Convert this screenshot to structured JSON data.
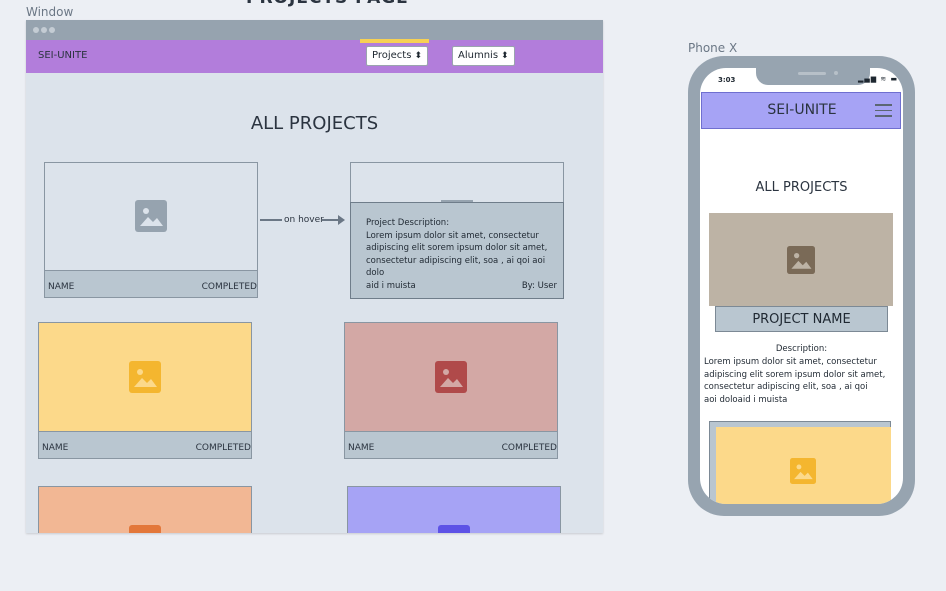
{
  "page_heading": "PROJECTS PAGE",
  "window_label": "Window",
  "phone_label": "Phone X",
  "desktop": {
    "brand": "SEI-UNITE",
    "nav_selects": [
      {
        "label": "Projects",
        "arrow": "⬍"
      },
      {
        "label": "Alumnis",
        "arrow": "⬍"
      }
    ],
    "heading": "ALL PROJECTS",
    "hover_label": "on hover",
    "cards": [
      {
        "name": "NAME",
        "status": "COMPLETED",
        "color": "#dce3eb",
        "icon_color": "#96a3af"
      },
      {
        "name": "NAME",
        "status": "COMPLETED",
        "color": "#fcd98a",
        "icon_color": "#f4b62f"
      },
      {
        "name": "NAME",
        "status": "COMPLETED",
        "color": "#d3a8a5",
        "icon_color": "#b04a4a"
      },
      {
        "name": "",
        "status": "",
        "color": "#f2b794",
        "icon_color": "#e3773a"
      },
      {
        "name": "",
        "status": "",
        "color": "#a6a3f5",
        "icon_color": "#5d52e6"
      }
    ],
    "hover_card": {
      "desc_title": "Project Description:",
      "desc_lines": [
        "Lorem ipsum dolor sit amet, consectetur",
        "adipiscing elit sorem ipsum dolor sit amet,",
        "consectetur adipiscing elit, soa , ai qoi  aoi dolo",
        "aid i muista"
      ],
      "by": "By: User"
    }
  },
  "phone": {
    "time": "3:03",
    "status_icons": "▂▄▆ ≋ ▬",
    "brand": "SEI-UNITE",
    "heading": "ALL PROJECTS",
    "project_name": "PROJECT NAME",
    "desc_title": "Description:",
    "desc_lines": [
      "Lorem ipsum dolor sit amet, consectetur",
      "adipiscing elit sorem ipsum dolor sit amet,",
      "consectetur adipiscing elit, soa , ai qoi",
      "aoi doloaid i muista"
    ],
    "img1_icon_color": "#7a6a57",
    "img2_icon_color": "#f4b62f"
  }
}
